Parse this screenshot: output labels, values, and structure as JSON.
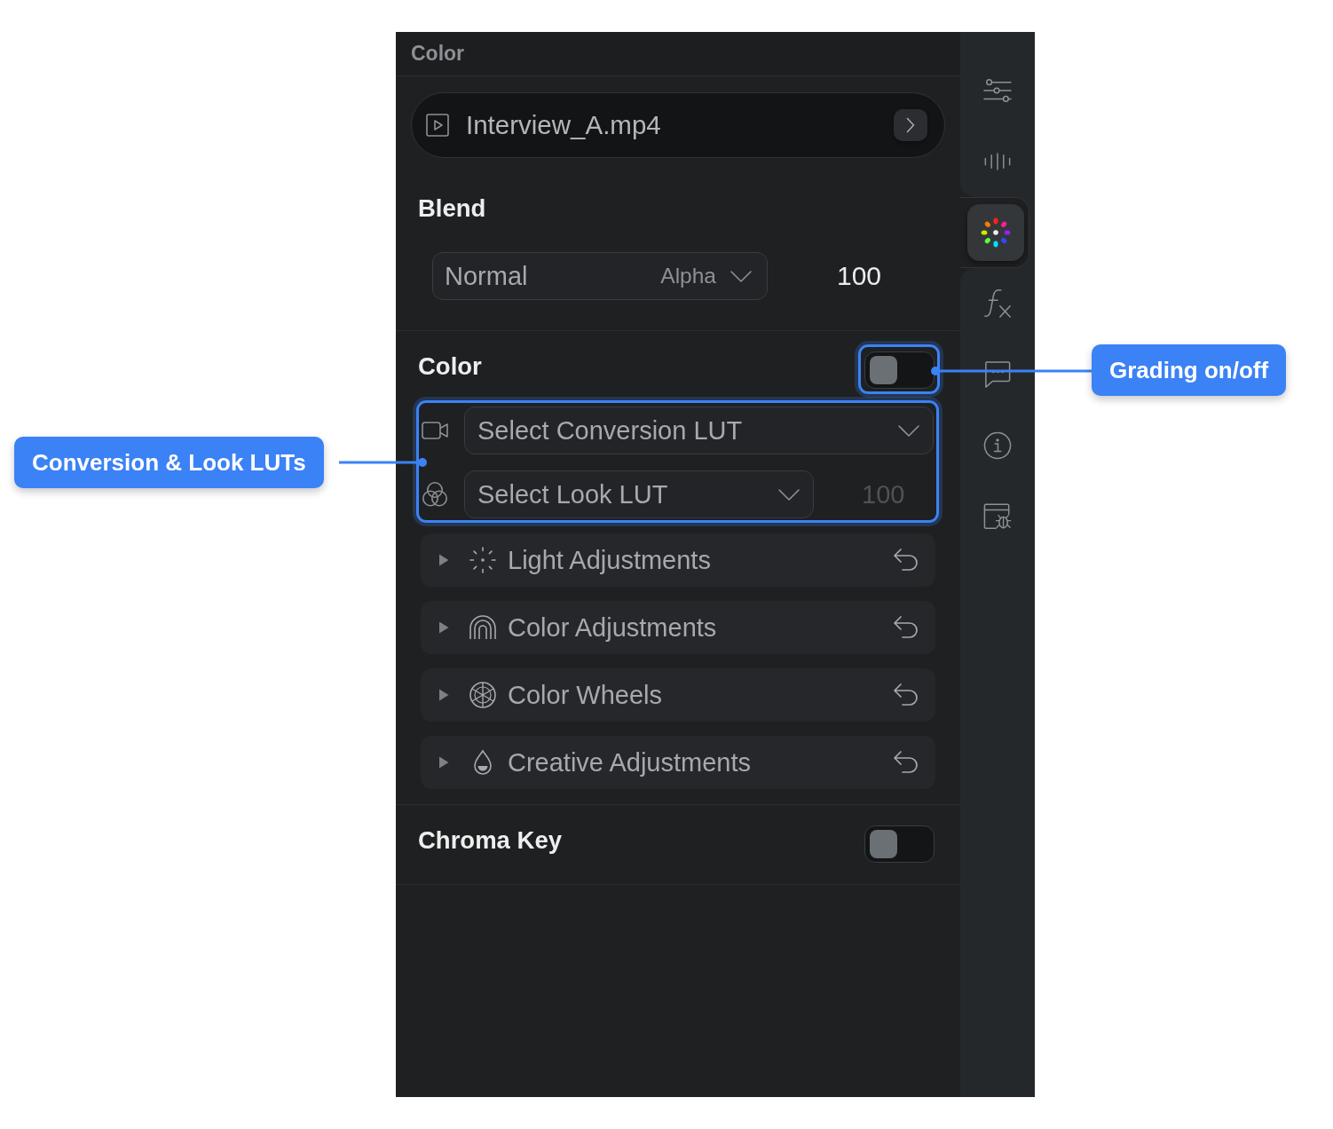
{
  "panel": {
    "title": "Color"
  },
  "source": {
    "filename": "Interview_A.mp4"
  },
  "blend": {
    "label": "Blend",
    "mode": "Normal",
    "channel": "Alpha",
    "opacity": "100"
  },
  "color": {
    "label": "Color",
    "on": false,
    "callout": "Grading on/off",
    "luts": {
      "callout": "Conversion & Look LUTs",
      "conversion": {
        "placeholder": "Select Conversion LUT"
      },
      "look": {
        "placeholder": "Select Look LUT",
        "amount": "100",
        "disabled": true
      }
    },
    "adjustments": [
      {
        "kind": "light",
        "label": "Light Adjustments",
        "expanded": false
      },
      {
        "kind": "color",
        "label": "Color Adjustments",
        "expanded": false
      },
      {
        "kind": "wheels",
        "label": "Color Wheels",
        "expanded": false
      },
      {
        "kind": "creative",
        "label": "Creative Adjustments",
        "expanded": false
      }
    ]
  },
  "chroma_key": {
    "label": "Chroma Key",
    "on": false
  },
  "sidebar": {
    "items": [
      {
        "kind": "sliders",
        "selected": false
      },
      {
        "kind": "waveform",
        "selected": false
      },
      {
        "kind": "color",
        "selected": true
      },
      {
        "kind": "effects",
        "selected": false
      },
      {
        "kind": "captions",
        "selected": false
      },
      {
        "kind": "info",
        "selected": false
      },
      {
        "kind": "debug",
        "selected": false
      }
    ]
  }
}
